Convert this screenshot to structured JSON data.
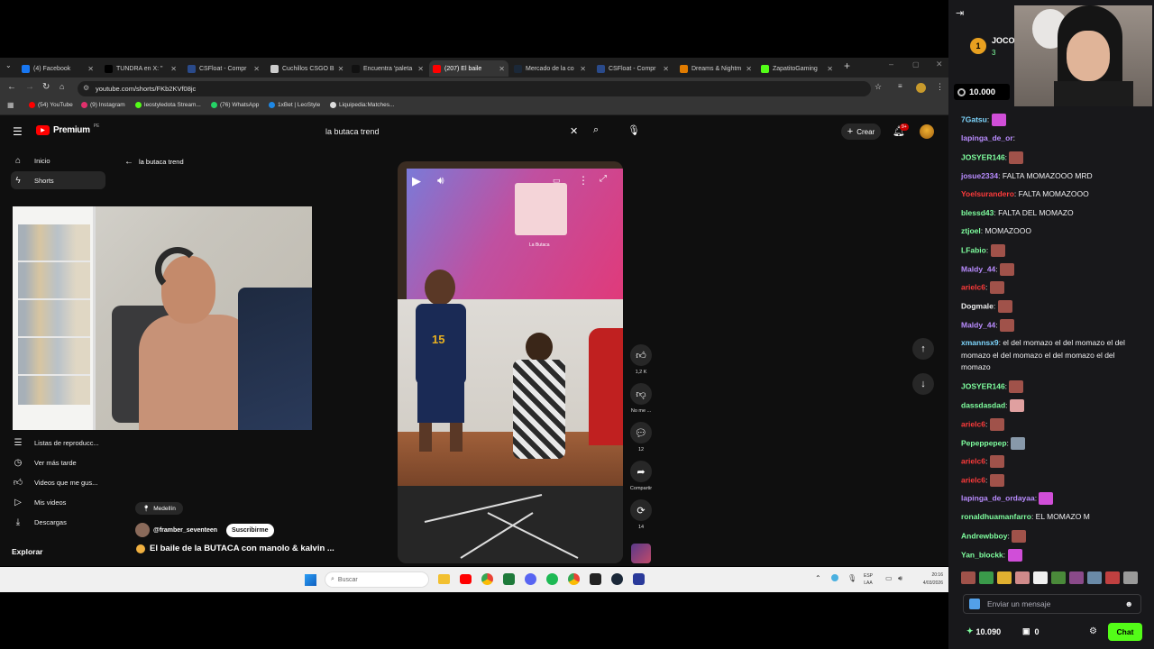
{
  "browser": {
    "tabs": [
      {
        "label": "(4) Facebook",
        "color": "#1877f2"
      },
      {
        "label": "TUNDRA en X: \"",
        "color": "#000000"
      },
      {
        "label": "CSFloat - Compr",
        "color": "#2a4a8a"
      },
      {
        "label": "Cuchillos CSGO B",
        "color": "#cccccc"
      },
      {
        "label": "Encuentra 'paleta",
        "color": "#111111"
      },
      {
        "label": "(207) El baile",
        "color": "#ff0000"
      },
      {
        "label": "Mercado de la co",
        "color": "#1b2838"
      },
      {
        "label": "CSFloat - Compr",
        "color": "#2a4a8a"
      },
      {
        "label": "Dreams & Nightm",
        "color": "#e07b00"
      },
      {
        "label": "ZapatitoGaming",
        "color": "#53fc18"
      }
    ],
    "url": "youtube.com/shorts/FKb2KVf08jc",
    "bookmarks": [
      {
        "label": "(54) YouTube",
        "color": "#ff0000"
      },
      {
        "label": "(9) Instagram",
        "color": "#e1306c"
      },
      {
        "label": "leostyledota Stream...",
        "color": "#53fc18"
      },
      {
        "label": "(76) WhatsApp",
        "color": "#25d366"
      },
      {
        "label": "1xBet | LeoStyle",
        "color": "#1e88e5"
      },
      {
        "label": "Liquipedia:Matches...",
        "color": "#dddddd"
      }
    ]
  },
  "youtube": {
    "logo_text": "Premium",
    "logo_sup": "PE",
    "search_value": "la butaca trend",
    "create_label": "Crear",
    "notif_badge": "9+",
    "back_label": "la butaca trend",
    "sidebar_top": [
      {
        "label": "Inicio",
        "icon": "home-icon"
      },
      {
        "label": "Shorts",
        "icon": "shorts-icon"
      }
    ],
    "sidebar_bottom": [
      {
        "label": "Listas de reproducc...",
        "icon": "playlist-icon"
      },
      {
        "label": "Ver más tarde",
        "icon": "clock-icon"
      },
      {
        "label": "Videos que me gus...",
        "icon": "like-icon"
      },
      {
        "label": "Mis videos",
        "icon": "video-icon"
      },
      {
        "label": "Descargas",
        "icon": "download-icon"
      }
    ],
    "explore_label": "Explorar",
    "location": "Medellín",
    "channel": "@framber_seventeen",
    "subscribe_label": "Suscribirme",
    "video_title": "El baile de la BUTACA con manolo & kalvin ...",
    "likes": "1,2 K",
    "dislike_label": "No me ...",
    "comments": "12",
    "share_label": "Compartir",
    "remix_count": "14",
    "tv_label": "La Butaca"
  },
  "taskbar": {
    "search_placeholder": "Buscar",
    "lang_line1": "ESP",
    "lang_line2": "LAA",
    "time": "20:16",
    "date": "4/03/2026"
  },
  "twitch": {
    "sub_prefix": "JOCO",
    "sub_count": "3",
    "channel_points": "10.000",
    "input_placeholder": "Enviar un mensaje",
    "balance": "10.090",
    "bits": "0",
    "chat_button": "Chat",
    "messages": [
      {
        "user": "7Gatsu",
        "color": "#7fd7ff",
        "text": "",
        "emote": "#d04ed8"
      },
      {
        "user": "lapinga_de_or",
        "color": "#b98cff",
        "text": "",
        "emote": ""
      },
      {
        "user": "JOSYER146",
        "color": "#7fff9f",
        "text": "",
        "emote": "#a0524a"
      },
      {
        "user": "josue2334",
        "color": "#b98cff",
        "text": "FALTA MOMAZOOO MRD",
        "emote": ""
      },
      {
        "user": "Yoelsurandero",
        "color": "#ff3b3b",
        "text": "FALTA MOMAZOOO",
        "emote": ""
      },
      {
        "user": "blessd43",
        "color": "#7fff9f",
        "text": "FALTA DEL MOMAZO",
        "emote": ""
      },
      {
        "user": "ztjoel",
        "color": "#7fff9f",
        "text": "MOMAZOOO",
        "emote": ""
      },
      {
        "user": "LFabio",
        "color": "#7fff9f",
        "text": "",
        "emote": "#a0524a"
      },
      {
        "user": "Maldy_44",
        "color": "#b98cff",
        "text": "",
        "emote": "#a0524a"
      },
      {
        "user": "arielc6",
        "color": "#ff3b3b",
        "text": "",
        "emote": "#a0524a"
      },
      {
        "user": "Dogmale",
        "color": "#f0f0f0",
        "text": "",
        "emote": "#a0524a"
      },
      {
        "user": "Maldy_44",
        "color": "#b98cff",
        "text": "",
        "emote": "#a0524a"
      },
      {
        "user": "xmannsx9",
        "color": "#7fd7ff",
        "text": "el del momazo el del momazo el del momazo el del momazo el del momazo el del momazo",
        "emote": ""
      },
      {
        "user": "JOSYER146",
        "color": "#7fff9f",
        "text": "",
        "emote": "#a0524a"
      },
      {
        "user": "dassdasdad",
        "color": "#7fff9f",
        "text": "",
        "emote": "#e0a0a0"
      },
      {
        "user": "arielc6",
        "color": "#ff3b3b",
        "text": "",
        "emote": "#a0524a"
      },
      {
        "user": "Pepeppepep",
        "color": "#7fff9f",
        "text": "",
        "emote": "#8899aa"
      },
      {
        "user": "arielc6",
        "color": "#ff3b3b",
        "text": "",
        "emote": "#a0524a"
      },
      {
        "user": "arielc6",
        "color": "#ff3b3b",
        "text": "",
        "emote": "#a0524a"
      },
      {
        "user": "lapinga_de_ordayaa",
        "color": "#b98cff",
        "text": "",
        "emote": "#d04ed8"
      },
      {
        "user": "ronaldhuamanfarro",
        "color": "#7fff9f",
        "text": "EL MOMAZO M",
        "emote": ""
      },
      {
        "user": "Andrewbboy",
        "color": "#7fff9f",
        "text": "",
        "emote": "#a0524a"
      },
      {
        "user": "Yan_blockk",
        "color": "#7fff9f",
        "text": "",
        "emote": "#d04ed8"
      }
    ]
  }
}
